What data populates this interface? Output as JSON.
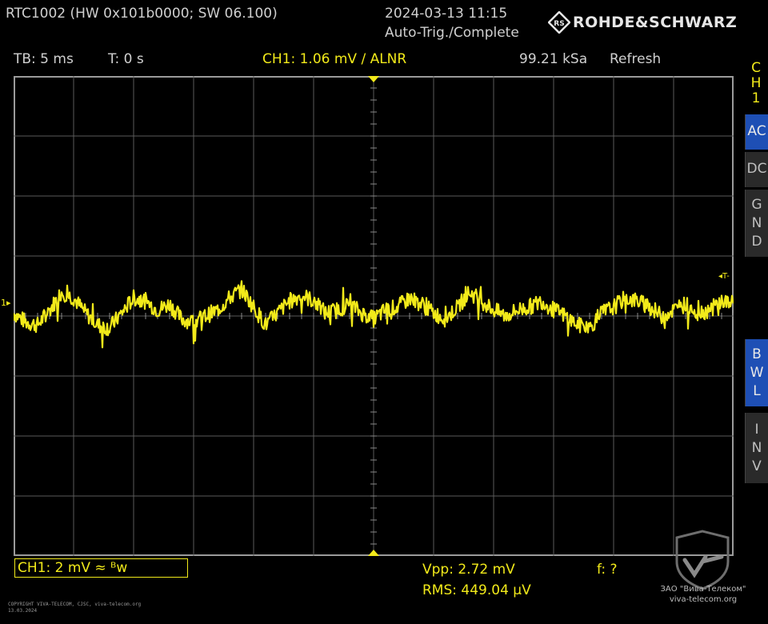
{
  "header": {
    "device": "RTC1002 (HW 0x101b0000; SW 06.100)",
    "datetime": "2024-03-13 11:15",
    "trigger_state": "Auto-Trig./Complete",
    "brand": "ROHDE&SCHWARZ"
  },
  "status_bar": {
    "timebase": "TB: 5 ms",
    "trigger_time": "T: 0 s",
    "trigger_info": "CH1: 1.06 mV / ALNR",
    "sample_rate": "99.21 kSa",
    "mode": "Refresh"
  },
  "side_menu": {
    "channel": [
      "C",
      "H",
      "1"
    ],
    "buttons": [
      {
        "name": "ac",
        "letters": [
          "AC"
        ],
        "active": true
      },
      {
        "name": "dc",
        "letters": [
          "DC"
        ],
        "active": false
      },
      {
        "name": "gnd",
        "letters": [
          "G",
          "N",
          "D"
        ],
        "active": false
      },
      {
        "name": "bwl",
        "letters": [
          "B",
          "W",
          "L"
        ],
        "active": true
      },
      {
        "name": "inv",
        "letters": [
          "I",
          "N",
          "V"
        ],
        "active": false
      }
    ]
  },
  "screen": {
    "channel_marker": "1",
    "trigger_marker": "T"
  },
  "bottom": {
    "channel_setting": "CH1: 2 mV ≈ ᴮᴡ",
    "vpp": "Vpp: 2.72 mV",
    "freq": "f: ?",
    "rms": "RMS: 449.04 µV"
  },
  "watermark": {
    "company": "ЗАО \"Вива-Телеком\"",
    "site": "viva-telecom.org",
    "copyright_line1": "COPYRIGHT VIVA-TELECOM, CJSC, viva-telecom.org",
    "copyright_line2": "13.03.2024"
  },
  "colors": {
    "trace": "#f2ea1a",
    "grid": "#5a5a5a",
    "active_button": "#1e4fb5"
  },
  "chart_data": {
    "type": "line",
    "x": [
      0,
      1,
      2,
      3,
      4,
      5,
      6,
      7,
      8,
      9,
      10,
      11,
      12,
      13,
      14,
      15,
      16,
      17,
      18,
      19,
      20,
      21,
      22,
      23,
      24,
      25,
      26,
      27,
      28,
      29,
      30,
      31,
      32,
      33,
      34,
      35,
      36,
      37,
      38,
      39,
      40,
      41,
      42,
      43,
      44,
      45,
      46,
      47,
      48,
      49,
      50,
      51,
      52,
      53,
      54,
      55,
      56,
      57,
      58,
      59,
      60
    ],
    "values": [
      0.1,
      -0.2,
      -0.3,
      0.2,
      0.8,
      0.6,
      0.1,
      -0.3,
      -0.4,
      0.1,
      0.6,
      0.5,
      0.2,
      0.4,
      -0.1,
      -0.2,
      0.0,
      0.2,
      0.6,
      0.9,
      0.3,
      -0.3,
      0.1,
      0.5,
      0.7,
      0.5,
      0.1,
      0.2,
      0.4,
      0.1,
      -0.1,
      0.2,
      0.3,
      0.6,
      0.4,
      0.1,
      -0.1,
      0.3,
      0.8,
      0.5,
      0.2,
      0.0,
      0.2,
      0.3,
      0.5,
      0.2,
      0.0,
      -0.3,
      -0.4,
      0.1,
      0.3,
      0.6,
      0.5,
      0.3,
      0.0,
      0.2,
      0.4,
      0.1,
      0.2,
      0.5,
      0.4
    ],
    "ylim": [
      -8,
      8
    ],
    "xlim": [
      0,
      60
    ],
    "grid": true
  }
}
